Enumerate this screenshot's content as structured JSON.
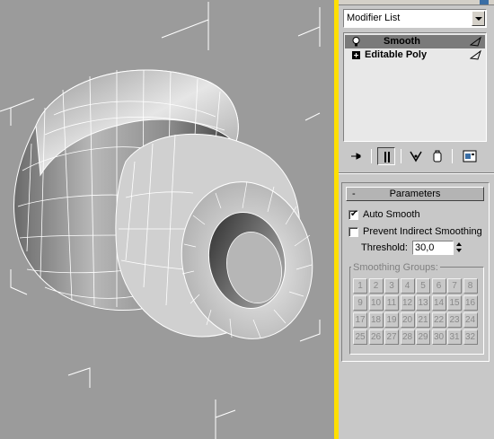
{
  "panel": {
    "modifier_list_label": "Modifier List",
    "stack_items": [
      {
        "label": "Smooth",
        "selected": true,
        "icon": "lightbulb-icon"
      },
      {
        "label": "Editable Poly",
        "selected": false,
        "icon": "expand-plus-icon"
      }
    ],
    "toolbar_icons": [
      "pin-stack-icon",
      "show-end-result-icon",
      "make-unique-icon",
      "remove-modifier-icon",
      "configure-modifier-sets-icon"
    ]
  },
  "parameters": {
    "title": "Parameters",
    "collapse_glyph": "-",
    "auto_smooth": {
      "label": "Auto Smooth",
      "checked": true
    },
    "prevent_indirect": {
      "label": "Prevent Indirect Smoothing",
      "checked": false
    },
    "threshold_label": "Threshold:",
    "threshold_value": "30,0",
    "smoothing_groups_label": "Smoothing Groups:",
    "smoothing_groups": [
      "1",
      "2",
      "3",
      "4",
      "5",
      "6",
      "7",
      "8",
      "9",
      "10",
      "11",
      "12",
      "13",
      "14",
      "15",
      "16",
      "17",
      "18",
      "19",
      "20",
      "21",
      "22",
      "23",
      "24",
      "25",
      "26",
      "27",
      "28",
      "29",
      "30",
      "31",
      "32"
    ]
  },
  "colors": {
    "viewport_bg": "#9b9b9b",
    "active_viewport_border": "#ffe000",
    "panel_bg": "#c8c8c8",
    "selected_row": "#7a7a7a"
  }
}
